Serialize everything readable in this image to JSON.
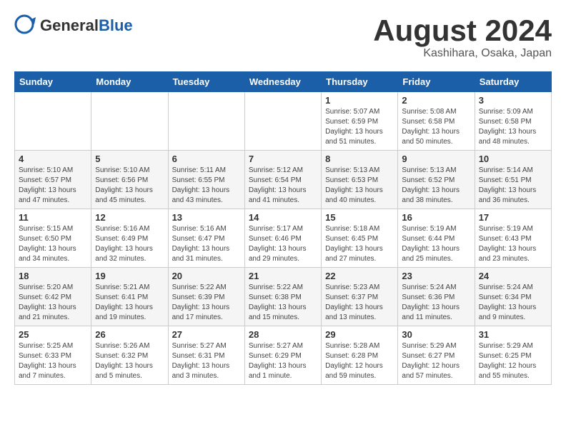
{
  "logo": {
    "general": "General",
    "blue": "Blue"
  },
  "title": {
    "month_year": "August 2024",
    "location": "Kashihara, Osaka, Japan"
  },
  "headers": [
    "Sunday",
    "Monday",
    "Tuesday",
    "Wednesday",
    "Thursday",
    "Friday",
    "Saturday"
  ],
  "weeks": [
    [
      {
        "day": "",
        "info": ""
      },
      {
        "day": "",
        "info": ""
      },
      {
        "day": "",
        "info": ""
      },
      {
        "day": "",
        "info": ""
      },
      {
        "day": "1",
        "info": "Sunrise: 5:07 AM\nSunset: 6:59 PM\nDaylight: 13 hours\nand 51 minutes."
      },
      {
        "day": "2",
        "info": "Sunrise: 5:08 AM\nSunset: 6:58 PM\nDaylight: 13 hours\nand 50 minutes."
      },
      {
        "day": "3",
        "info": "Sunrise: 5:09 AM\nSunset: 6:58 PM\nDaylight: 13 hours\nand 48 minutes."
      }
    ],
    [
      {
        "day": "4",
        "info": "Sunrise: 5:10 AM\nSunset: 6:57 PM\nDaylight: 13 hours\nand 47 minutes."
      },
      {
        "day": "5",
        "info": "Sunrise: 5:10 AM\nSunset: 6:56 PM\nDaylight: 13 hours\nand 45 minutes."
      },
      {
        "day": "6",
        "info": "Sunrise: 5:11 AM\nSunset: 6:55 PM\nDaylight: 13 hours\nand 43 minutes."
      },
      {
        "day": "7",
        "info": "Sunrise: 5:12 AM\nSunset: 6:54 PM\nDaylight: 13 hours\nand 41 minutes."
      },
      {
        "day": "8",
        "info": "Sunrise: 5:13 AM\nSunset: 6:53 PM\nDaylight: 13 hours\nand 40 minutes."
      },
      {
        "day": "9",
        "info": "Sunrise: 5:13 AM\nSunset: 6:52 PM\nDaylight: 13 hours\nand 38 minutes."
      },
      {
        "day": "10",
        "info": "Sunrise: 5:14 AM\nSunset: 6:51 PM\nDaylight: 13 hours\nand 36 minutes."
      }
    ],
    [
      {
        "day": "11",
        "info": "Sunrise: 5:15 AM\nSunset: 6:50 PM\nDaylight: 13 hours\nand 34 minutes."
      },
      {
        "day": "12",
        "info": "Sunrise: 5:16 AM\nSunset: 6:49 PM\nDaylight: 13 hours\nand 32 minutes."
      },
      {
        "day": "13",
        "info": "Sunrise: 5:16 AM\nSunset: 6:47 PM\nDaylight: 13 hours\nand 31 minutes."
      },
      {
        "day": "14",
        "info": "Sunrise: 5:17 AM\nSunset: 6:46 PM\nDaylight: 13 hours\nand 29 minutes."
      },
      {
        "day": "15",
        "info": "Sunrise: 5:18 AM\nSunset: 6:45 PM\nDaylight: 13 hours\nand 27 minutes."
      },
      {
        "day": "16",
        "info": "Sunrise: 5:19 AM\nSunset: 6:44 PM\nDaylight: 13 hours\nand 25 minutes."
      },
      {
        "day": "17",
        "info": "Sunrise: 5:19 AM\nSunset: 6:43 PM\nDaylight: 13 hours\nand 23 minutes."
      }
    ],
    [
      {
        "day": "18",
        "info": "Sunrise: 5:20 AM\nSunset: 6:42 PM\nDaylight: 13 hours\nand 21 minutes."
      },
      {
        "day": "19",
        "info": "Sunrise: 5:21 AM\nSunset: 6:41 PM\nDaylight: 13 hours\nand 19 minutes."
      },
      {
        "day": "20",
        "info": "Sunrise: 5:22 AM\nSunset: 6:39 PM\nDaylight: 13 hours\nand 17 minutes."
      },
      {
        "day": "21",
        "info": "Sunrise: 5:22 AM\nSunset: 6:38 PM\nDaylight: 13 hours\nand 15 minutes."
      },
      {
        "day": "22",
        "info": "Sunrise: 5:23 AM\nSunset: 6:37 PM\nDaylight: 13 hours\nand 13 minutes."
      },
      {
        "day": "23",
        "info": "Sunrise: 5:24 AM\nSunset: 6:36 PM\nDaylight: 13 hours\nand 11 minutes."
      },
      {
        "day": "24",
        "info": "Sunrise: 5:24 AM\nSunset: 6:34 PM\nDaylight: 13 hours\nand 9 minutes."
      }
    ],
    [
      {
        "day": "25",
        "info": "Sunrise: 5:25 AM\nSunset: 6:33 PM\nDaylight: 13 hours\nand 7 minutes."
      },
      {
        "day": "26",
        "info": "Sunrise: 5:26 AM\nSunset: 6:32 PM\nDaylight: 13 hours\nand 5 minutes."
      },
      {
        "day": "27",
        "info": "Sunrise: 5:27 AM\nSunset: 6:31 PM\nDaylight: 13 hours\nand 3 minutes."
      },
      {
        "day": "28",
        "info": "Sunrise: 5:27 AM\nSunset: 6:29 PM\nDaylight: 13 hours\nand 1 minute."
      },
      {
        "day": "29",
        "info": "Sunrise: 5:28 AM\nSunset: 6:28 PM\nDaylight: 12 hours\nand 59 minutes."
      },
      {
        "day": "30",
        "info": "Sunrise: 5:29 AM\nSunset: 6:27 PM\nDaylight: 12 hours\nand 57 minutes."
      },
      {
        "day": "31",
        "info": "Sunrise: 5:29 AM\nSunset: 6:25 PM\nDaylight: 12 hours\nand 55 minutes."
      }
    ]
  ]
}
